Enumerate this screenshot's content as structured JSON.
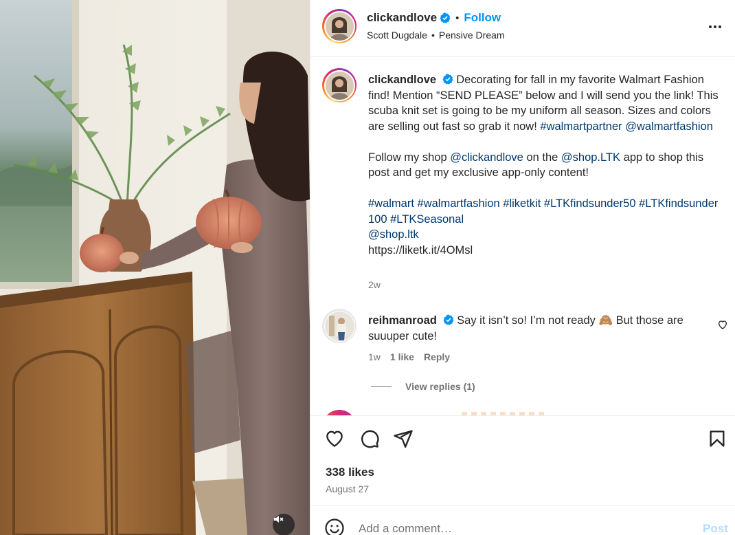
{
  "header": {
    "username": "clickandlove",
    "separator": "•",
    "follow_label": "Follow",
    "artist": "Scott Dugdale",
    "audio_separator": "•",
    "track": "Pensive Dream",
    "more_icon": "more-horizontal-icon"
  },
  "caption": {
    "username": "clickandlove",
    "line1": "Decorating for fall in my favorite Walmart Fashion find! Mention “SEND PLEASE” below and I will send you the link! This scuba knit set is going to be my uniform all season. Sizes and colors are selling out fast so grab it now!",
    "tag1": "#walmartpartner",
    "tag2": "@walmartfashion",
    "para2_a": "Follow my shop ",
    "para2_tag1": "@clickandlove",
    "para2_b": " on the ",
    "para2_tag2": "@shop.LTK",
    "para2_c": " app to shop this post and get my exclusive app-only content!",
    "hashtags": [
      "#walmart",
      "#walmartfashion",
      "#liketkit",
      "#LTKfindsunder50",
      "#LTKfindsunder100",
      "#LTKSeasonal"
    ],
    "mention": "@shop.ltk",
    "link": "https://liketk.it/4OMsl",
    "time": "2w"
  },
  "comment": {
    "username": "reihmanroad",
    "text_a": "Say it isn’t so! I’m not ready ",
    "emoji": "🙈",
    "text_b": " But those are suuuper cute!",
    "time": "1w",
    "likes": "1 like",
    "reply_label": "Reply",
    "view_replies": "View replies (1)"
  },
  "actions": {
    "likes": "338 likes",
    "date": "August 27"
  },
  "add_comment": {
    "placeholder": "Add a comment…",
    "post_label": "Post"
  },
  "colors": {
    "accent": "#0095f6",
    "link": "#00376b",
    "muted": "#737373",
    "post_disabled": "#b3dbff"
  }
}
